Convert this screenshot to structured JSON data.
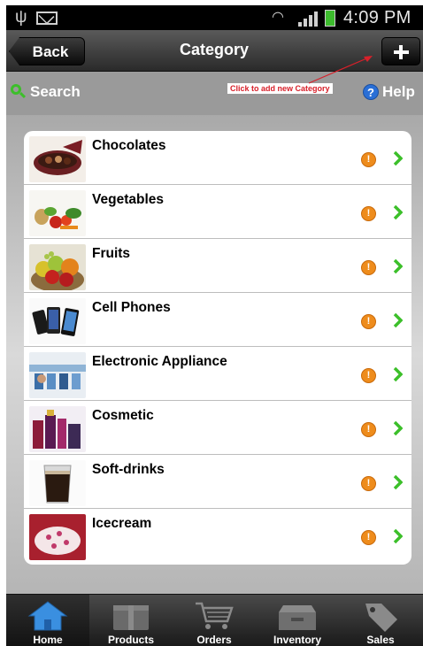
{
  "status_bar": {
    "time": "4:09 PM"
  },
  "header": {
    "back_label": "Back",
    "title": "Category"
  },
  "toolbar": {
    "search_label": "Search",
    "hint_text": "Click to add new Category",
    "help_label": "Help"
  },
  "categories": [
    {
      "name": "Chocolates"
    },
    {
      "name": "Vegetables"
    },
    {
      "name": "Fruits"
    },
    {
      "name": "Cell Phones"
    },
    {
      "name": "Electronic  Appliance"
    },
    {
      "name": "Cosmetic"
    },
    {
      "name": "Soft-drinks"
    },
    {
      "name": "Icecream"
    }
  ],
  "tabs": [
    {
      "label": "Home",
      "icon": "home-icon",
      "active": true
    },
    {
      "label": "Products",
      "icon": "products-icon"
    },
    {
      "label": "Orders",
      "icon": "cart-icon"
    },
    {
      "label": "Inventory",
      "icon": "inventory-icon"
    },
    {
      "label": "Sales",
      "icon": "tag-icon"
    }
  ],
  "colors": {
    "accent_green": "#3cbf2a",
    "info_orange": "#ee8c1c",
    "hint_red": "#d8202a",
    "help_blue": "#2a6fd6"
  }
}
